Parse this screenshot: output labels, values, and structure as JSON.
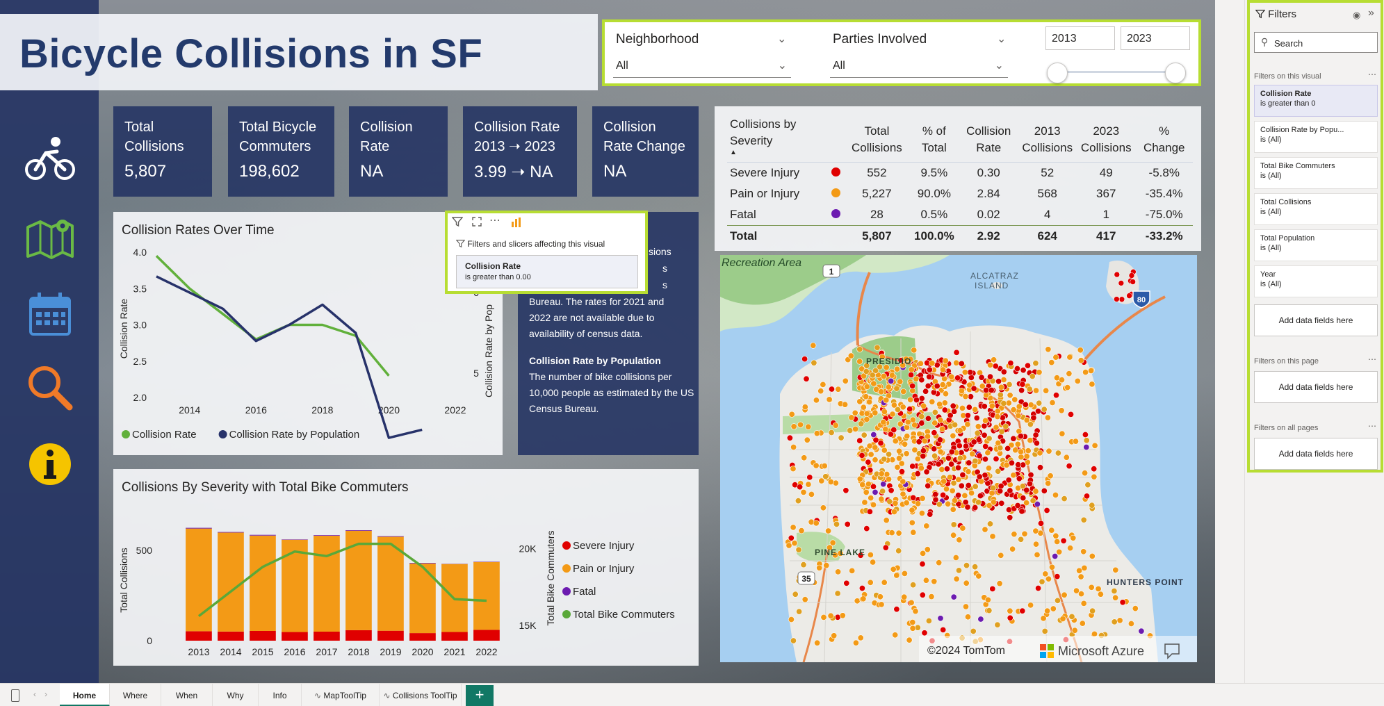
{
  "title": "Bicycle Collisions in SF",
  "slicers": {
    "neighborhood": {
      "label": "Neighborhood",
      "value": "All"
    },
    "parties": {
      "label": "Parties Involved",
      "value": "All"
    },
    "year_start": "2013",
    "year_end": "2023"
  },
  "kpis": [
    {
      "title": "Total Collisions",
      "value": "5,807"
    },
    {
      "title": "Total Bicycle Commuters",
      "value": "198,602"
    },
    {
      "title": "Collision Rate",
      "value": "NA"
    },
    {
      "title": "Collision Rate 2013 ➝ 2023",
      "value": "3.99 ➝ NA"
    },
    {
      "title": "Collision Rate Change",
      "value": "NA"
    }
  ],
  "line_chart": {
    "title": "Collision Rates Over Time",
    "ylabel_left": "Collision Rate",
    "ylabel_right": "Collision Rate by Pop",
    "left_ticks": [
      "4.0",
      "3.5",
      "3.0",
      "2.5",
      "2.0"
    ],
    "right_ticks": [
      "6",
      "5"
    ],
    "x_ticks": [
      "2014",
      "2016",
      "2018",
      "2020",
      "2022"
    ],
    "legend": [
      "Collision Rate",
      "Collision Rate by Population"
    ]
  },
  "tooltip": {
    "title": "Filters and slicers affecting this visual",
    "field": "Collision Rate",
    "condition": "is greater than 0.00"
  },
  "info": {
    "partial_line1": "sions",
    "partial_line2": "s",
    "partial_line3": "s",
    "line_a": "Bureau. The rates for 2021 and",
    "line_b": "2022 are not available due to",
    "line_c": "availability of census data.",
    "heading2": "Collision Rate by Population",
    "para2": "The number of bike collisions per 10,000 people as estimated by the US Census Bureau."
  },
  "bar_chart": {
    "title": "Collisions By Severity with Total Bike Commuters",
    "ylabel_left": "Total Collisions",
    "ylabel_right": "Total Bike Commuters",
    "left_ticks": [
      "500",
      "0"
    ],
    "right_ticks": [
      "20K",
      "15K"
    ],
    "legend": [
      "Severe Injury",
      "Pain or Injury",
      "Fatal",
      "Total Bike Commuters"
    ]
  },
  "severity_table": {
    "headers": [
      "Collisions by Severity",
      "Total Collisions",
      "% of Total",
      "Collision Rate",
      "2013 Collisions",
      "2023 Collisions",
      "% Change"
    ],
    "rows": [
      {
        "name": "Severe Injury",
        "color": "#e00000",
        "vals": [
          "552",
          "9.5%",
          "0.30",
          "52",
          "49",
          "-5.8%"
        ]
      },
      {
        "name": "Pain or Injury",
        "color": "#f39a16",
        "vals": [
          "5,227",
          "90.0%",
          "2.84",
          "568",
          "367",
          "-35.4%"
        ]
      },
      {
        "name": "Fatal",
        "color": "#6c1bb0",
        "vals": [
          "28",
          "0.5%",
          "0.02",
          "4",
          "1",
          "-75.0%"
        ]
      }
    ],
    "total": {
      "name": "Total",
      "vals": [
        "5,807",
        "100.0%",
        "2.92",
        "624",
        "417",
        "-33.2%"
      ]
    }
  },
  "map": {
    "labels": [
      "Recreation Area",
      "ALCATRAZ ISLAND",
      "PRESIDIO",
      "PINE LAKE",
      "HUNTERS POINT"
    ],
    "shields": [
      "1",
      "80",
      "35"
    ],
    "copyright": "©2024 TomTom",
    "brand": "Microsoft Azure"
  },
  "filters_pane": {
    "title": "Filters",
    "search": "Search",
    "section_visual": "Filters on this visual",
    "section_page": "Filters on this page",
    "section_all": "Filters on all pages",
    "add": "Add data fields here",
    "cards": [
      {
        "name": "Collision Rate",
        "cond": "is greater than 0"
      },
      {
        "name": "Collision Rate by Popu...",
        "cond": "is (All)"
      },
      {
        "name": "Total Bike Commuters",
        "cond": "is (All)"
      },
      {
        "name": "Total Collisions",
        "cond": "is (All)"
      },
      {
        "name": "Total Population",
        "cond": "is (All)"
      },
      {
        "name": "Year",
        "cond": "is (All)"
      }
    ]
  },
  "tabs": [
    "Home",
    "Where",
    "When",
    "Why",
    "Info",
    "MapToolTip",
    "Collisions ToolTip"
  ],
  "colors": {
    "navy": "#263564",
    "accent": "#b7dd33",
    "severe": "#e00000",
    "pain": "#f39a16",
    "fatal": "#6c1bb0",
    "commuters": "#5aa839",
    "rate_green": "#61b03b",
    "rate_navy": "#27326a"
  },
  "chart_data": [
    {
      "type": "line",
      "title": "Collision Rates Over Time",
      "xlabel": "",
      "ylabel": "Collision Rate",
      "x": [
        2013,
        2014,
        2015,
        2016,
        2017,
        2018,
        2019,
        2020,
        2021,
        2022
      ],
      "series": [
        {
          "name": "Collision Rate",
          "axis": "left",
          "values": [
            3.95,
            3.5,
            3.15,
            2.8,
            3.0,
            3.0,
            2.85,
            2.3,
            null,
            null
          ]
        },
        {
          "name": "Collision Rate by Population",
          "axis": "right",
          "values": [
            6.2,
            6.0,
            5.8,
            5.4,
            5.6,
            5.85,
            5.5,
            4.2,
            4.3,
            null
          ]
        }
      ],
      "ylim_left": [
        2.0,
        4.0
      ],
      "ylim_right": [
        4.7,
        6.5
      ],
      "grid": false,
      "legend": "bottom"
    },
    {
      "type": "bar",
      "title": "Collisions By Severity with Total Bike Commuters",
      "ylabel": "Total Collisions",
      "ylabel_right": "Total Bike Commuters",
      "categories": [
        "2013",
        "2014",
        "2015",
        "2016",
        "2017",
        "2018",
        "2019",
        "2020",
        "2021",
        "2022"
      ],
      "series": [
        {
          "name": "Severe Injury",
          "values": [
            52,
            50,
            54,
            48,
            50,
            58,
            55,
            42,
            48,
            60
          ]
        },
        {
          "name": "Pain or Injury",
          "values": [
            568,
            548,
            527,
            510,
            530,
            550,
            520,
            385,
            376,
            375
          ]
        },
        {
          "name": "Fatal",
          "values": [
            4,
            3,
            4,
            2,
            3,
            3,
            3,
            3,
            1,
            2
          ]
        },
        {
          "name": "Total Bike Commuters",
          "type": "line",
          "axis": "right",
          "values": [
            15600,
            17200,
            18800,
            19800,
            19500,
            20300,
            20300,
            18800,
            16700,
            16600
          ]
        }
      ],
      "ylim": [
        0,
        680
      ],
      "ylim_right": [
        14000,
        22000
      ],
      "legend": "right"
    }
  ]
}
